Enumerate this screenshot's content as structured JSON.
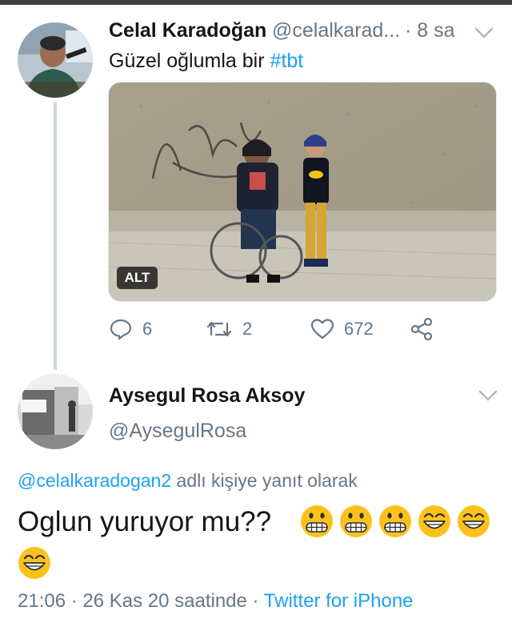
{
  "parent_tweet": {
    "display_name": "Celal Karadoğan",
    "handle": "@celalkarad...",
    "time": "· 8 sa",
    "text_plain": "Güzel oğlumla bir ",
    "hashtag": "#tbt",
    "media_alt_badge": "ALT",
    "actions": {
      "reply_count": "6",
      "retweet_count": "2",
      "like_count": "672"
    }
  },
  "reply_tweet": {
    "display_name": "Aysegul Rosa Aksoy",
    "handle": "@AysegulRosa",
    "replying_to_mention": "@celalkaradogan2",
    "replying_to_text": " adlı kişiye yanıt olarak",
    "text": "Oglun yuruyor mu??",
    "emojis": [
      "grimacing-face",
      "grimacing-face",
      "grimacing-face",
      "grinning-face-smiling-eyes",
      "grinning-face-smiling-eyes",
      "grinning-face-smiling-eyes"
    ],
    "timestamp": "21:06 · 26 Kas 20 saatinde · ",
    "source": "Twitter for iPhone"
  },
  "colors": {
    "link_blue": "#1da1f2",
    "muted_gray": "#657786",
    "thread_line": "#ccd6dd",
    "emoji_yellow": "#fcc21b"
  }
}
